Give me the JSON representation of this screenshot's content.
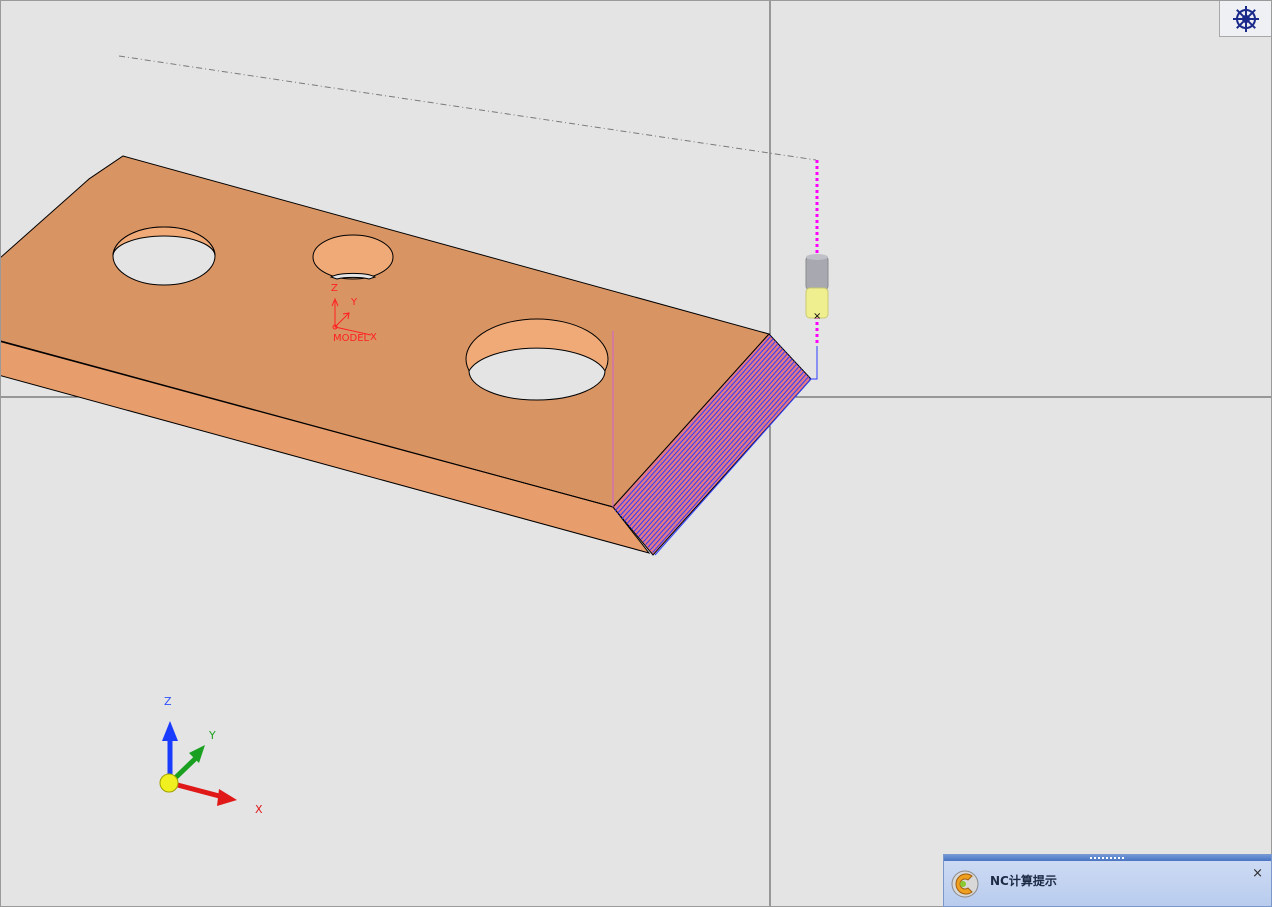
{
  "viewport": {
    "background": "#e4e4e4",
    "part_colors": {
      "top": "#d99464",
      "front": "#e89d6c",
      "side": "#c57e52",
      "hole_wall": "#efaa78"
    },
    "toolpath_color": "#2c3cff",
    "tool_path_dotted_color": "#ff00ff",
    "crosshair_color": "#555555",
    "model_axis": {
      "z": "Z",
      "y": "Y",
      "x": "X",
      "label": "MODEL",
      "color": "#ff2020"
    },
    "view_triad": {
      "z": "Z",
      "y": "Y",
      "x": "X"
    },
    "tool_marker": "×",
    "corner_icon": "view-control-wheel-icon"
  },
  "nc_panel": {
    "title": "NC计算提示",
    "close": "×",
    "icon": "nc-calc-icon"
  }
}
